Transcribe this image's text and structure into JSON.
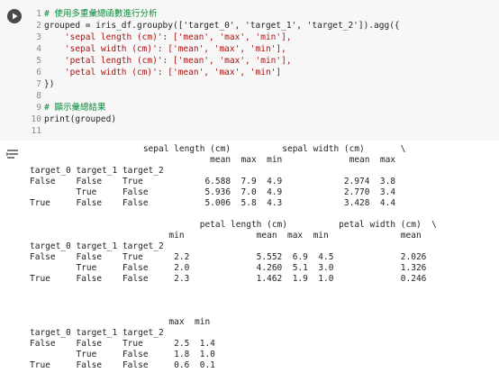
{
  "code_cell": {
    "lines": [
      {
        "num": "1",
        "text": "# 使用多重彙總函數進行分析"
      },
      {
        "num": "2",
        "text": "grouped = iris_df.groupby(['target_0', 'target_1', 'target_2']).agg({"
      },
      {
        "num": "3",
        "text": "    'sepal length (cm)': ['mean', 'max', 'min'],"
      },
      {
        "num": "4",
        "text": "    'sepal width (cm)': ['mean', 'max', 'min'],"
      },
      {
        "num": "5",
        "text": "    'petal length (cm)': ['mean', 'max', 'min'],"
      },
      {
        "num": "6",
        "text": "    'petal width (cm)': ['mean', 'max', 'min']"
      },
      {
        "num": "7",
        "text": "})"
      },
      {
        "num": "8",
        "text": ""
      },
      {
        "num": "9",
        "text": "# 顯示彙總結果"
      },
      {
        "num": "10",
        "text": "print(grouped)"
      },
      {
        "num": "11",
        "text": ""
      }
    ]
  },
  "output": {
    "lines": [
      "                      sepal length (cm)          sepal width (cm)       \\",
      "                                   mean  max  min             mean  max",
      "target_0 target_1 target_2",
      "False    False    True            6.588  7.9  4.9            2.974  3.8",
      "         True     False           5.936  7.0  4.9            2.770  3.4",
      "True     False    False           5.006  5.8  4.3            3.428  4.4",
      "",
      "                                 petal length (cm)          petal width (cm)  \\",
      "                           min              mean  max  min              mean",
      "target_0 target_1 target_2",
      "False    False    True      2.2             5.552  6.9  4.5             2.026",
      "         True     False     2.0             4.260  5.1  3.0             1.326",
      "True     False    False     2.3             1.462  1.9  1.0             0.246",
      "",
      "",
      "",
      "                           max  min",
      "target_0 target_1 target_2",
      "False    False    True      2.5  1.4",
      "         True     False     1.8  1.0",
      "True     False    False     0.6  0.1"
    ]
  },
  "icons": {
    "run": "play-icon",
    "output_toggle": "output-toggle-icon"
  },
  "colors": {
    "comment": "#0a8a3a",
    "string": "#a31515",
    "cell_bg": "#f7f7f7"
  }
}
